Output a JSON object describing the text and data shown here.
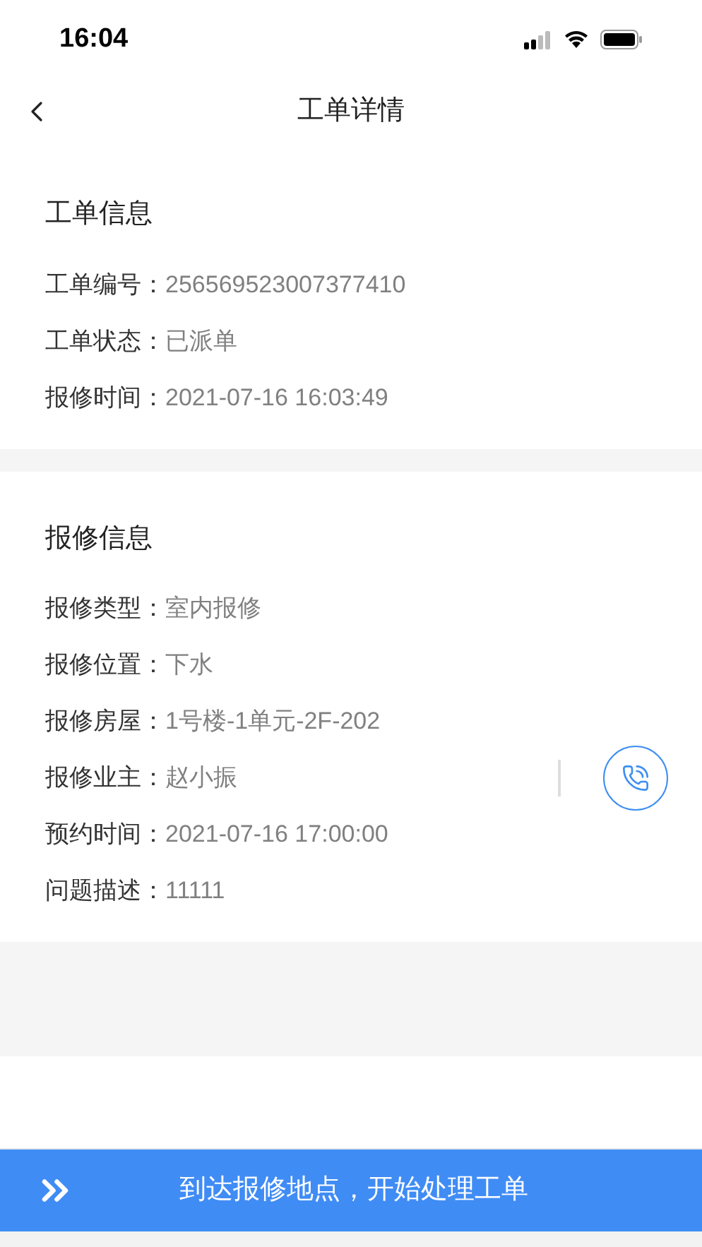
{
  "status_bar": {
    "time": "16:04"
  },
  "nav": {
    "title": "工单详情"
  },
  "sections": [
    {
      "title": "工单信息",
      "rows": [
        {
          "kind": "text",
          "label": "工单编号：",
          "value": "256569523007377410"
        },
        {
          "kind": "text",
          "label": "工单状态：",
          "value": "已派单"
        },
        {
          "kind": "text",
          "label": "报修时间：",
          "value": "2021-07-16 16:03:49"
        }
      ]
    },
    {
      "title": "报修信息",
      "rows": [
        {
          "kind": "text",
          "label": "报修类型：",
          "value": "室内报修"
        },
        {
          "kind": "text",
          "label": "报修位置：",
          "value": "下水"
        },
        {
          "kind": "text",
          "label": "报修房屋：",
          "value": "1号楼-1单元-2F-202"
        },
        {
          "kind": "contact",
          "label": "报修业主：",
          "value": "赵小振"
        },
        {
          "kind": "text",
          "label": "预约时间：",
          "value": "2021-07-16 17:00:00"
        },
        {
          "kind": "text",
          "label": "问题描述：",
          "value": "11111"
        }
      ]
    }
  ],
  "action_button": {
    "label": "到达报修地点，开始处理工单"
  }
}
